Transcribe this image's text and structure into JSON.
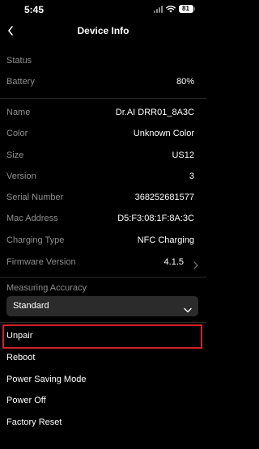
{
  "status_bar": {
    "time": "5:45",
    "battery": "81"
  },
  "header": {
    "title": "Device Info"
  },
  "status_section": {
    "heading": "Status",
    "battery_label": "Battery",
    "battery_value": "80%"
  },
  "details": [
    {
      "label": "Name",
      "value": "Dr.AI DRR01_8A3C"
    },
    {
      "label": "Color",
      "value": "Unknown Color"
    },
    {
      "label": "Size",
      "value": "US12"
    },
    {
      "label": "Version",
      "value": "3"
    },
    {
      "label": "Serial Number",
      "value": "368252681577"
    },
    {
      "label": "Mac Address",
      "value": "D5:F3:08:1F:8A:3C"
    },
    {
      "label": "Charging Type",
      "value": "NFC Charging"
    },
    {
      "label": "Firmware Version",
      "value": "4.1.5"
    }
  ],
  "accuracy": {
    "label": "Measuring Accuracy",
    "selected": "Standard"
  },
  "actions": [
    {
      "label": "Unpair"
    },
    {
      "label": "Reboot"
    },
    {
      "label": "Power Saving Mode"
    },
    {
      "label": "Power Off"
    },
    {
      "label": "Factory Reset"
    }
  ],
  "colors": {
    "background": "#000000",
    "secondary_text": "#8f8f8f",
    "highlight": "#d3202a",
    "select_bg": "#2b2b2b"
  }
}
